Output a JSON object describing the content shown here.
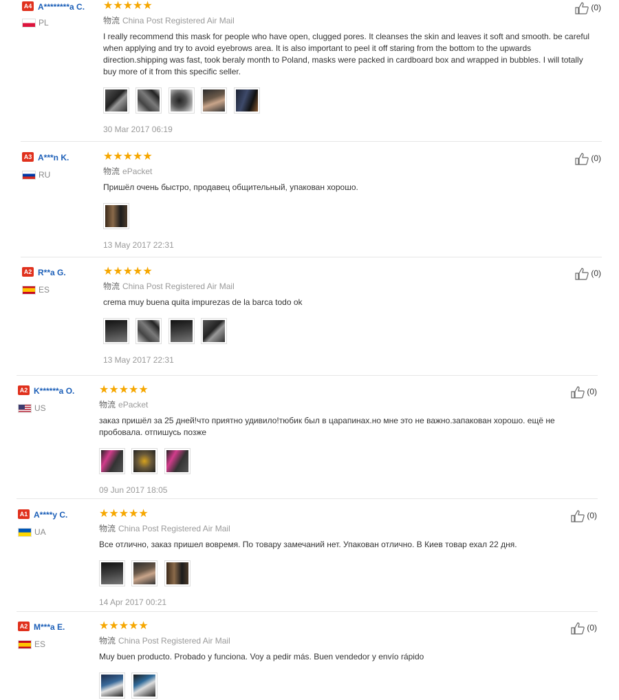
{
  "ship_label": "物流",
  "reviews": [
    {
      "level": "A4",
      "name": "A********a C.",
      "country": "PL",
      "flag": "pl",
      "stars": "★★★★★",
      "shipping": "China Post Registered Air Mail",
      "text": "I really recommend this mask for people who have open, clugged pores. It cleanses the skin and leaves it soft and smooth. be careful when applying and try to avoid eyebrows area. It is also important to peel it off staring from the bottom to the upwards direction.shipping was fast, took beraly month to Poland, masks were packed in cardboard box and wrapped in bubbles. I will totally buy more of it from this specific seller.",
      "photo_count": 5,
      "date": "30 Mar 2017 06:19",
      "helpful": "(0)"
    },
    {
      "level": "A3",
      "name": "A***n K.",
      "country": "RU",
      "flag": "ru",
      "stars": "★★★★★",
      "shipping": "ePacket",
      "text": "Пришёл очень быстро, продавец общительный, упакован хорошо.",
      "photo_count": 1,
      "date": "13 May 2017 22:31",
      "helpful": "(0)"
    },
    {
      "level": "A2",
      "name": "R**a G.",
      "country": "ES",
      "flag": "es",
      "stars": "★★★★★",
      "shipping": "China Post Registered Air Mail",
      "text": "crema muy buena quita impurezas de la barca todo ok",
      "photo_count": 4,
      "date": "13 May 2017 22:31",
      "helpful": "(0)"
    },
    {
      "level": "A2",
      "name": "K******a O.",
      "country": "US",
      "flag": "us",
      "stars": "★★★★★",
      "shipping": "ePacket",
      "text": "заказ пришёл за 25 дней!что приятно удивило!тюбик был в царапинах.но мне это не важно.запакован хорошо. ещё не пробовала. отпишусь позже",
      "photo_count": 3,
      "date": "09 Jun 2017 18:05",
      "helpful": "(0)"
    },
    {
      "level": "A1",
      "name": "A****y C.",
      "country": "UA",
      "flag": "ua",
      "stars": "★★★★★",
      "shipping": "China Post Registered Air Mail",
      "text": "Все отлично, заказ пришел вовремя. По товару замечаний нет. Упакован отлично. В Киев товар ехал 22 дня.",
      "photo_count": 3,
      "date": "14 Apr 2017 00:21",
      "helpful": "(0)"
    },
    {
      "level": "A2",
      "name": "M***a E.",
      "country": "ES",
      "flag": "es",
      "stars": "★★★★★",
      "shipping": "China Post Registered Air Mail",
      "text": "Muy buen producto. Probado y funciona. Voy a pedir más. Buen vendedor y envío rápido",
      "photo_count": 2,
      "date": "",
      "helpful": "(0)"
    }
  ]
}
